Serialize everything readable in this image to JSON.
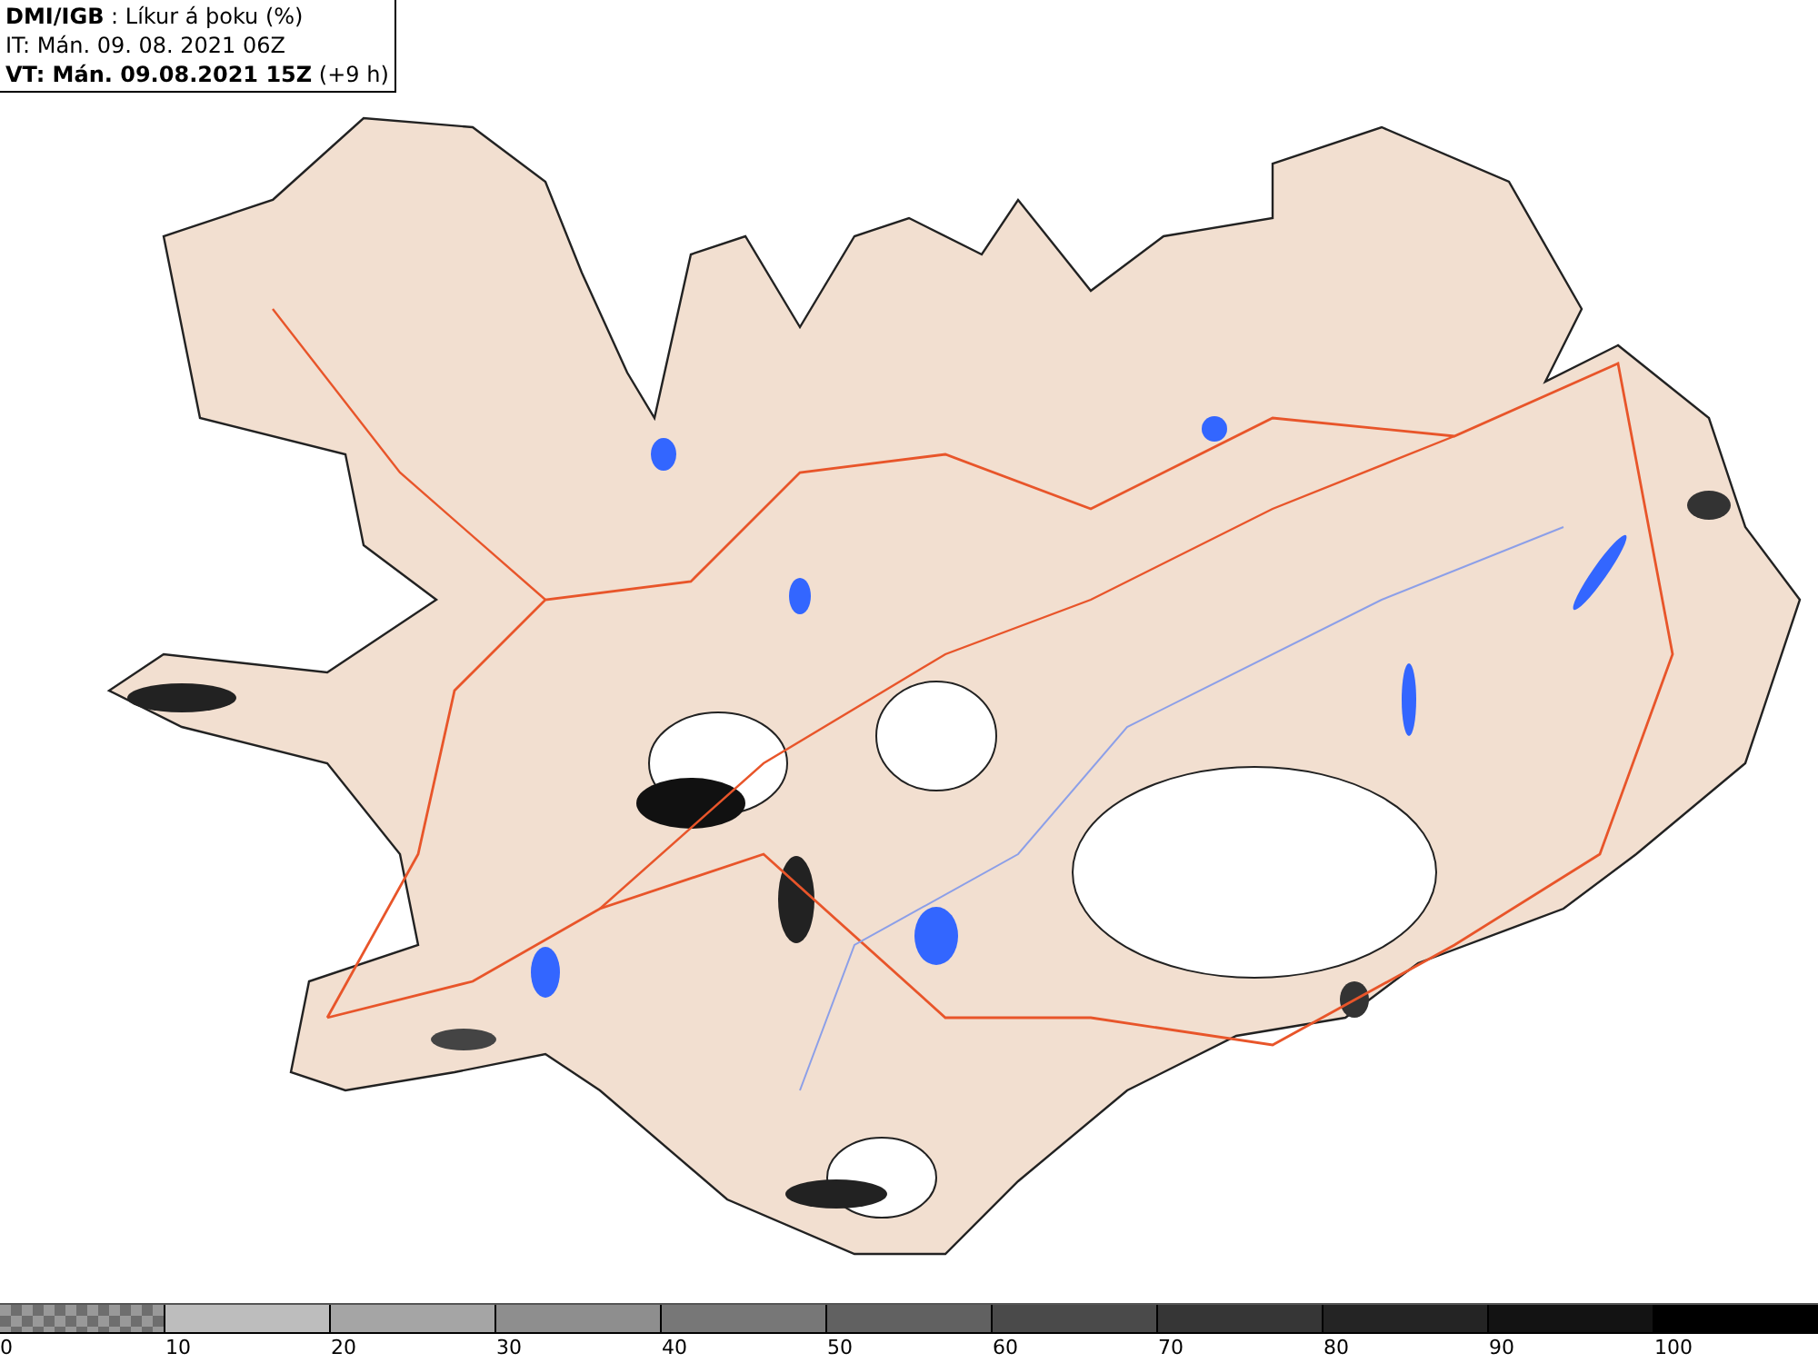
{
  "header": {
    "lines": [
      "**DMI/IGB** : Líkur á þoku (%)",
      "IT: Mán. 09. 08. 2021 06Z",
      "**VT: Mán. 09.08.2021 15Z** (+9 h)"
    ]
  },
  "legend": {
    "segments": [
      {
        "kind": "checker",
        "color": "#6e6e6e"
      },
      {
        "kind": "solid",
        "color": "#bdbdbd"
      },
      {
        "kind": "solid",
        "color": "#a5a5a5"
      },
      {
        "kind": "solid",
        "color": "#8e8e8e"
      },
      {
        "kind": "solid",
        "color": "#777777"
      },
      {
        "kind": "solid",
        "color": "#616161"
      },
      {
        "kind": "solid",
        "color": "#4a4a4a"
      },
      {
        "kind": "solid",
        "color": "#363636"
      },
      {
        "kind": "solid",
        "color": "#242424"
      },
      {
        "kind": "solid",
        "color": "#131313"
      },
      {
        "kind": "solid",
        "color": "#000000"
      }
    ],
    "labels": [
      "0",
      "10",
      "20",
      "30",
      "40",
      "50",
      "60",
      "70",
      "80",
      "90",
      "100"
    ]
  }
}
